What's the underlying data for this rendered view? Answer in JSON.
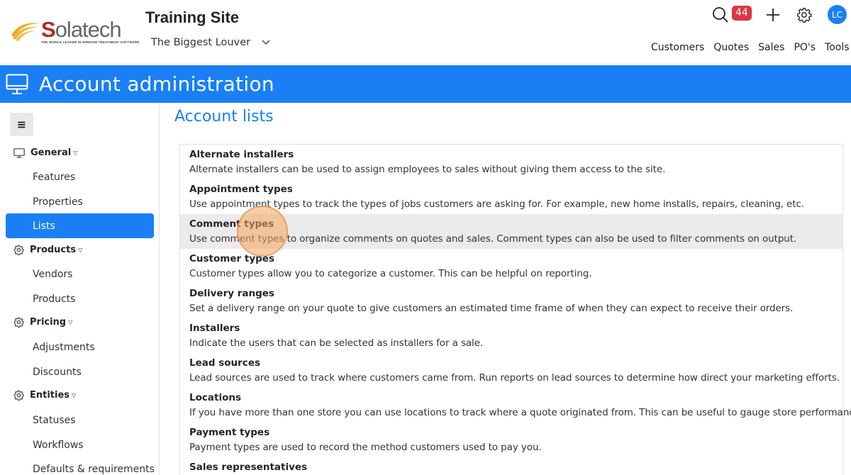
{
  "brand": {
    "logo_text": "Solatech",
    "tagline": "THE WORLD LEADER IN WINDOW TREATMENT SOFTWARE"
  },
  "header": {
    "site_title": "Training Site",
    "company": "The Biggest Louver",
    "notification_count": "44",
    "user_initials": "LC",
    "nav": [
      "Customers",
      "Quotes",
      "Sales",
      "PO's",
      "Tools"
    ]
  },
  "page": {
    "title": "Account administration",
    "section_title": "Account lists"
  },
  "sidebar": {
    "sections": [
      {
        "label": "General",
        "icon": "monitor-icon",
        "items": [
          "Features",
          "Properties",
          "Lists"
        ]
      },
      {
        "label": "Products",
        "icon": "gear-icon",
        "items": [
          "Vendors",
          "Products"
        ]
      },
      {
        "label": "Pricing",
        "icon": "gear-icon",
        "items": [
          "Adjustments",
          "Discounts"
        ]
      },
      {
        "label": "Entities",
        "icon": "gear-icon",
        "items": [
          "Statuses",
          "Workflows",
          "Defaults & requirements"
        ]
      }
    ],
    "active_item": "Lists"
  },
  "lists": [
    {
      "title": "Alternate installers",
      "description": "Alternate installers can be used to assign employees to sales without giving them access to the site."
    },
    {
      "title": "Appointment types",
      "description": "Use appointment types to track the types of jobs customers are asking for. For example, new home installs, repairs, cleaning, etc."
    },
    {
      "title": "Comment types",
      "description": "Use comment types to organize comments on quotes and sales. Comment types can also be used to filter comments on output."
    },
    {
      "title": "Customer types",
      "description": "Customer types allow you to categorize a customer. This can be helpful on reporting."
    },
    {
      "title": "Delivery ranges",
      "description": "Set a delivery range on your quote to give customers an estimated time frame of when they can expect to receive their orders."
    },
    {
      "title": "Installers",
      "description": "Indicate the users that can be selected as installers for a sale."
    },
    {
      "title": "Lead sources",
      "description": "Lead sources are used to track where customers came from. Run reports on lead sources to determine how direct your marketing efforts."
    },
    {
      "title": "Locations",
      "description": "If you have more than one store you can use locations to track where a quote originated from. This can be useful to gauge store performance."
    },
    {
      "title": "Payment types",
      "description": "Payment types are used to record the method customers used to pay you."
    },
    {
      "title": "Sales representatives",
      "description": ""
    }
  ],
  "highlighted_item": "Comment types",
  "colors": {
    "accent": "#1a7ff5",
    "badge": "#dc3545",
    "logo_red": "#b22a1f",
    "highlight_row": "#ebebeb"
  }
}
